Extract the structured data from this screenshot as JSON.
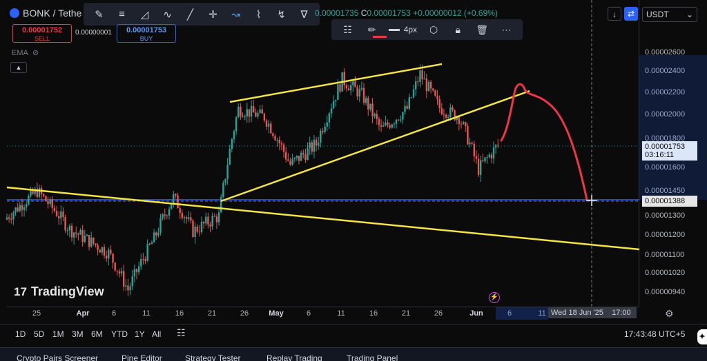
{
  "header": {
    "symbol": "BONK / Tethe",
    "ohlc_prefix": "C",
    "ohlc_partial": "0.00001735",
    "close": "0.00001753",
    "change": "+0.00000012 (+0.69%)"
  },
  "trade": {
    "sell_price": "0.00001752",
    "sell_label": "SELL",
    "spread": "0.00000001",
    "buy_price": "0.00001753",
    "buy_label": "BUY"
  },
  "indicator": {
    "name": "EMA"
  },
  "drawing_toolbar": {
    "icons": [
      "brush-icon",
      "parallel-lines-icon",
      "fib-icon",
      "pattern-icon",
      "trend-line-icon",
      "crosshair-icon",
      "projection-icon",
      "elliott-wave-icon",
      "zigzag-icon",
      "harmonic-pattern-icon"
    ]
  },
  "style_toolbar": {
    "stroke_width": "4px",
    "pen_color": "#f23645"
  },
  "price_scale": {
    "symbol_select": "USDT",
    "labels": [
      "0.00002600",
      "0.00002400",
      "0.00002200",
      "0.00002000",
      "0.00001800",
      "0.00001600",
      "0.00001450",
      "0.00001300",
      "0.00001200",
      "0.00001100",
      "0.00001020",
      "0.00000940"
    ],
    "current_price": "0.00001753",
    "countdown": "03:16:11",
    "cursor_price": "0.00001388"
  },
  "time_axis": {
    "labels": [
      "25",
      "Apr",
      "6",
      "11",
      "16",
      "21",
      "26",
      "May",
      "6",
      "11",
      "16",
      "21",
      "26",
      "Jun",
      "6",
      "11"
    ],
    "bold": [
      "Apr",
      "May",
      "Jun"
    ],
    "cursor_time": "Wed 18 Jun '25",
    "cursor_clock": "17:00"
  },
  "ranges": [
    "1D",
    "5D",
    "1M",
    "3M",
    "6M",
    "YTD",
    "1Y",
    "All"
  ],
  "clock": "17:43:48 UTC+5",
  "bottom_tabs": [
    "Crypto Pairs Screener",
    "Pine Editor",
    "Strategy Tester",
    "Replay Trading",
    "Trading Panel"
  ],
  "branding": "TradingView",
  "colors": {
    "up": "#26a69a",
    "down": "#ef5350",
    "trendline": "#f5e642",
    "drawing": "#f23645",
    "accent": "#2962ff"
  },
  "chart_data": {
    "type": "candlestick",
    "xlabel": "",
    "ylabel": "",
    "ylim": [
      9.1e-06,
      2.72e-05
    ],
    "last_close": 1.753e-05,
    "cursor_price": 1.388e-05,
    "segments": [
      {
        "date": "Mar 21",
        "price": 1.28e-05
      },
      {
        "date": "Mar 26",
        "price": 1.45e-05
      },
      {
        "date": "Mar 31",
        "price": 1.23e-05
      },
      {
        "date": "Apr 6",
        "price": 1.11e-05
      },
      {
        "date": "Apr 9",
        "price": 9.5e-06
      },
      {
        "date": "Apr 13",
        "price": 1.18e-05
      },
      {
        "date": "Apr 16",
        "price": 1.41e-05
      },
      {
        "date": "Apr 19",
        "price": 1.22e-05
      },
      {
        "date": "Apr 23",
        "price": 1.3e-05
      },
      {
        "date": "Apr 26",
        "price": 2.05e-05
      },
      {
        "date": "Apr 30",
        "price": 1.98e-05
      },
      {
        "date": "May 4",
        "price": 1.62e-05
      },
      {
        "date": "May 8",
        "price": 1.76e-05
      },
      {
        "date": "May 12",
        "price": 2.32e-05
      },
      {
        "date": "May 15",
        "price": 2.18e-05
      },
      {
        "date": "May 18",
        "price": 1.87e-05
      },
      {
        "date": "May 22",
        "price": 2.05e-05
      },
      {
        "date": "May 24",
        "price": 2.37e-05
      },
      {
        "date": "May 27",
        "price": 2.06e-05
      },
      {
        "date": "May 30",
        "price": 1.98e-05
      },
      {
        "date": "Jun 2",
        "price": 1.59e-05
      },
      {
        "date": "Jun 5",
        "price": 1.753e-05
      }
    ]
  }
}
